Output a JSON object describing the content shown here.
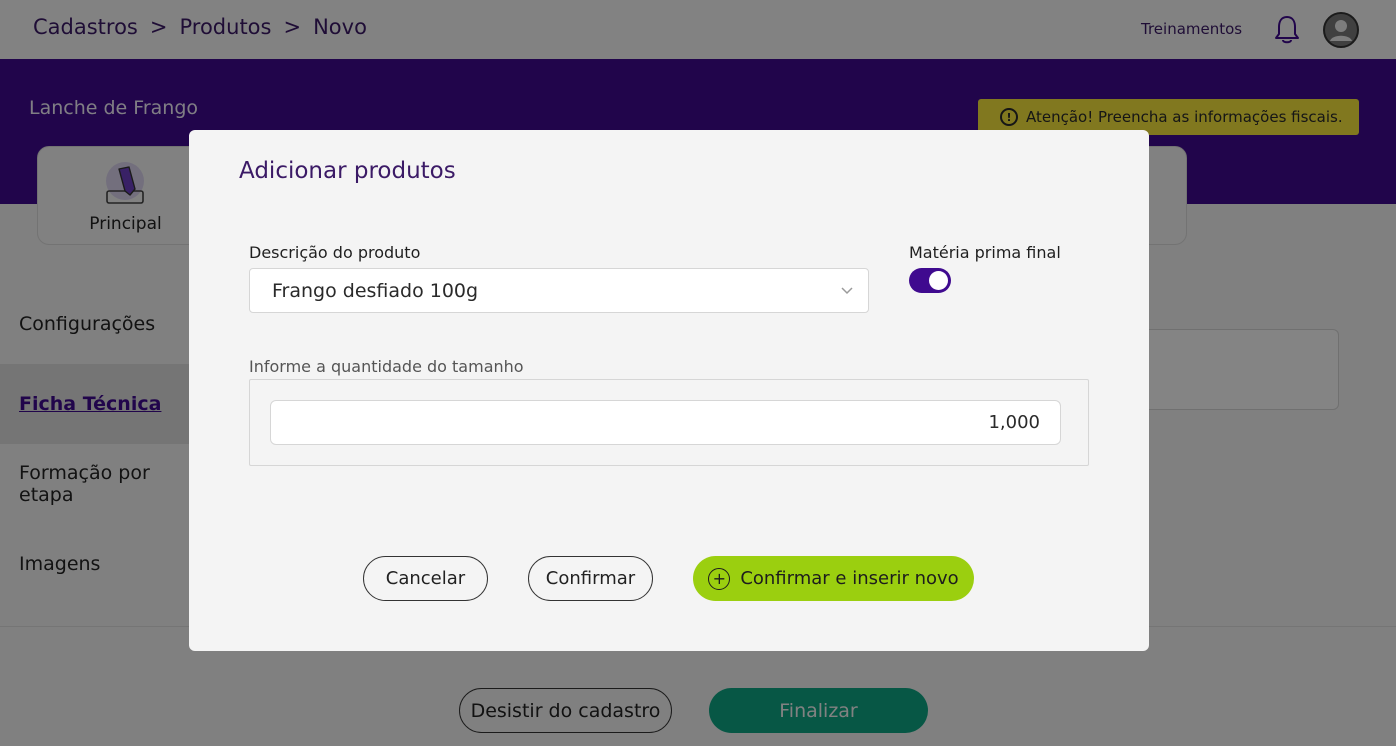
{
  "breadcrumb": {
    "items": [
      "Cadastros",
      "Produtos",
      "Novo"
    ],
    "separator": ">"
  },
  "topbar": {
    "link_label": "Treinamentos",
    "icons": [
      "bell-icon",
      "avatar-icon"
    ]
  },
  "hero": {
    "product_name": "Lanche de Frango",
    "alert": {
      "icon": "exclamation-circle-icon",
      "icon_glyph": "!",
      "text": "Atenção! Preencha as informações fiscais."
    }
  },
  "tabs": {
    "principal_label": "Principal",
    "principal_icon": "pencil-edit-icon"
  },
  "sidebar": {
    "items": [
      {
        "label": "Configurações"
      },
      {
        "label": "Ficha Técnica",
        "active": true
      },
      {
        "label": "Formação por etapa"
      },
      {
        "label": "Imagens"
      }
    ]
  },
  "footer": {
    "quit_label": "Desistir do cadastro",
    "finish_label": "Finalizar"
  },
  "modal": {
    "title": "Adicionar produtos",
    "description_label": "Descrição do produto",
    "description_value": "Frango desfiado 100g",
    "final_material_label": "Matéria prima final",
    "final_material_on": true,
    "quantity_label": "Informe a quantidade do tamanho",
    "quantity_value": "1,000",
    "cancel_label": "Cancelar",
    "confirm_label": "Confirmar",
    "confirm_new_label": "Confirmar e inserir novo",
    "confirm_new_icon": "plus-circle-icon",
    "confirm_new_icon_glyph": "+"
  },
  "colors": {
    "brand_purple": "#3f0a8f",
    "alert_yellow": "#f3e33b",
    "confirm_green": "#9bcf0f",
    "finish_teal": "#0fa583"
  }
}
